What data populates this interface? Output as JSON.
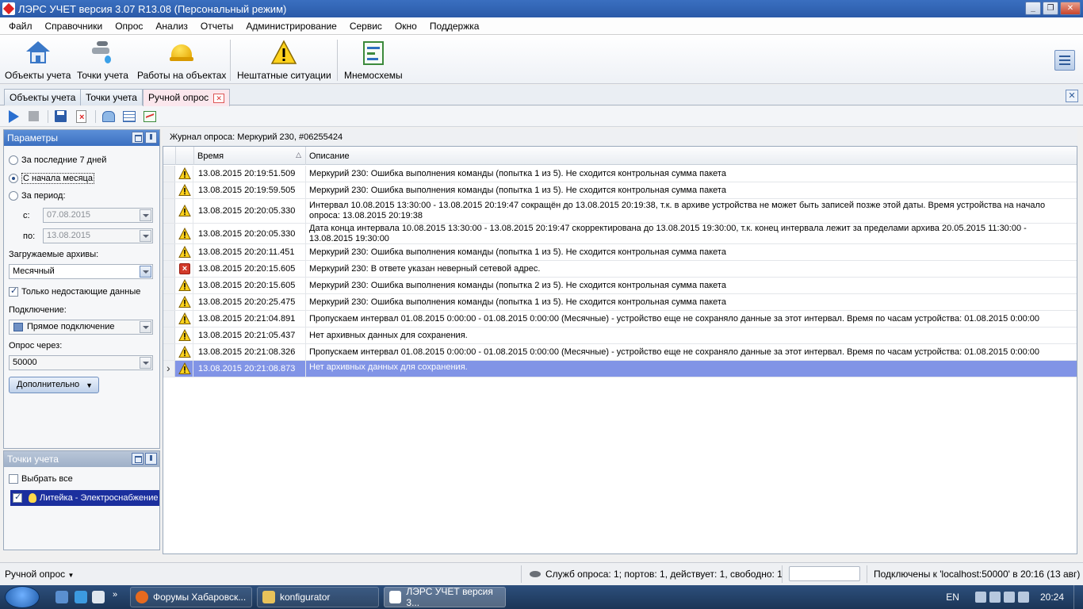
{
  "window": {
    "title": "ЛЭРС УЧЕТ версия 3.07 R13.08 (Персональный режим)"
  },
  "menu": [
    "Файл",
    "Справочники",
    "Опрос",
    "Анализ",
    "Отчеты",
    "Администрирование",
    "Сервис",
    "Окно",
    "Поддержка"
  ],
  "ribbon": {
    "objects": "Объекты учета",
    "points": "Точки учета",
    "works": "Работы на объектах",
    "incidents": "Нештатные ситуации",
    "mnemo": "Мнемосхемы"
  },
  "tabs": [
    "Объекты учета",
    "Точки учета",
    "Ручной опрос"
  ],
  "params": {
    "title": "Параметры",
    "last7": "За последние 7 дней",
    "month_start": "С начала месяца",
    "period": "За период:",
    "from_label": "с:",
    "from_value": "07.08.2015",
    "to_label": "по:",
    "to_value": "13.08.2015",
    "archives_label": "Загружаемые архивы:",
    "archives_value": "Месячный",
    "only_missing": "Только недостающие данные",
    "connection_label": "Подключение:",
    "connection_value": "Прямое подключение",
    "via_label": "Опрос через:",
    "via_value": "50000",
    "more": "Дополнительно"
  },
  "points_panel": {
    "title": "Точки учета",
    "select_all": "Выбрать все",
    "item": "Литейка - Электроснабжение"
  },
  "journal": {
    "title": "Журнал опроса: Меркурий 230, #06255424",
    "col_time": "Время",
    "col_desc": "Описание",
    "rows": [
      {
        "type": "warning",
        "time": "13.08.2015 20:19:51.509",
        "desc": "Меркурий 230: Ошибка выполнения команды (попытка 1 из 5). Не сходится контрольная сумма пакета"
      },
      {
        "type": "warning",
        "time": "13.08.2015 20:19:59.505",
        "desc": "Меркурий 230: Ошибка выполнения команды (попытка 1 из 5). Не сходится контрольная сумма пакета"
      },
      {
        "type": "warning",
        "time": "13.08.2015 20:20:05.330",
        "desc": "Интервал 10.08.2015 13:30:00 - 13.08.2015 20:19:47 сокращён до 13.08.2015 20:19:38, т.к. в архиве устройства не может быть записей позже этой даты. Время устройства на начало опроса: 13.08.2015 20:19:38"
      },
      {
        "type": "warning",
        "time": "13.08.2015 20:20:05.330",
        "desc": "Дата конца интервала 10.08.2015 13:30:00 - 13.08.2015 20:19:47 скорректирована до 13.08.2015 19:30:00, т.к. конец интервала лежит за пределами архива 20.05.2015 11:30:00 - 13.08.2015 19:30:00"
      },
      {
        "type": "warning",
        "time": "13.08.2015 20:20:11.451",
        "desc": "Меркурий 230: Ошибка выполнения команды (попытка 1 из 5). Не сходится контрольная сумма пакета"
      },
      {
        "type": "error",
        "time": "13.08.2015 20:20:15.605",
        "desc": "Меркурий 230: В ответе указан неверный сетевой адрес."
      },
      {
        "type": "warning",
        "time": "13.08.2015 20:20:15.605",
        "desc": "Меркурий 230: Ошибка выполнения команды (попытка 2 из 5). Не сходится контрольная сумма пакета"
      },
      {
        "type": "warning",
        "time": "13.08.2015 20:20:25.475",
        "desc": "Меркурий 230: Ошибка выполнения команды (попытка 1 из 5). Не сходится контрольная сумма пакета"
      },
      {
        "type": "warning",
        "time": "13.08.2015 20:21:04.891",
        "desc": "Пропускаем интервал 01.08.2015 0:00:00 - 01.08.2015 0:00:00 (Месячные) - устройство еще не сохраняло данные за этот интервал. Время по часам устройства: 01.08.2015 0:00:00"
      },
      {
        "type": "warning",
        "time": "13.08.2015 20:21:05.437",
        "desc": "Нет архивных данных для сохранения."
      },
      {
        "type": "warning",
        "time": "13.08.2015 20:21:08.326",
        "desc": "Пропускаем интервал 01.08.2015 0:00:00 - 01.08.2015 0:00:00 (Месячные) - устройство еще не сохраняло данные за этот интервал. Время по часам устройства: 01.08.2015 0:00:00"
      },
      {
        "type": "warning",
        "time": "13.08.2015 20:21:08.873",
        "desc": "Нет архивных данных для сохранения.",
        "selected": true
      }
    ]
  },
  "status": {
    "mode": "Ручной опрос",
    "services": "Служб опроса: 1; портов: 1, действует: 1, свободно: 1",
    "connected": "Подключены к 'localhost:50000' в 20:16 (13 авг)"
  },
  "taskbar": {
    "tasks": [
      "Форумы Хабаровск...",
      "konfigurator",
      "ЛЭРС УЧЕТ версия 3..."
    ],
    "lang": "EN",
    "clock": "20:24"
  }
}
